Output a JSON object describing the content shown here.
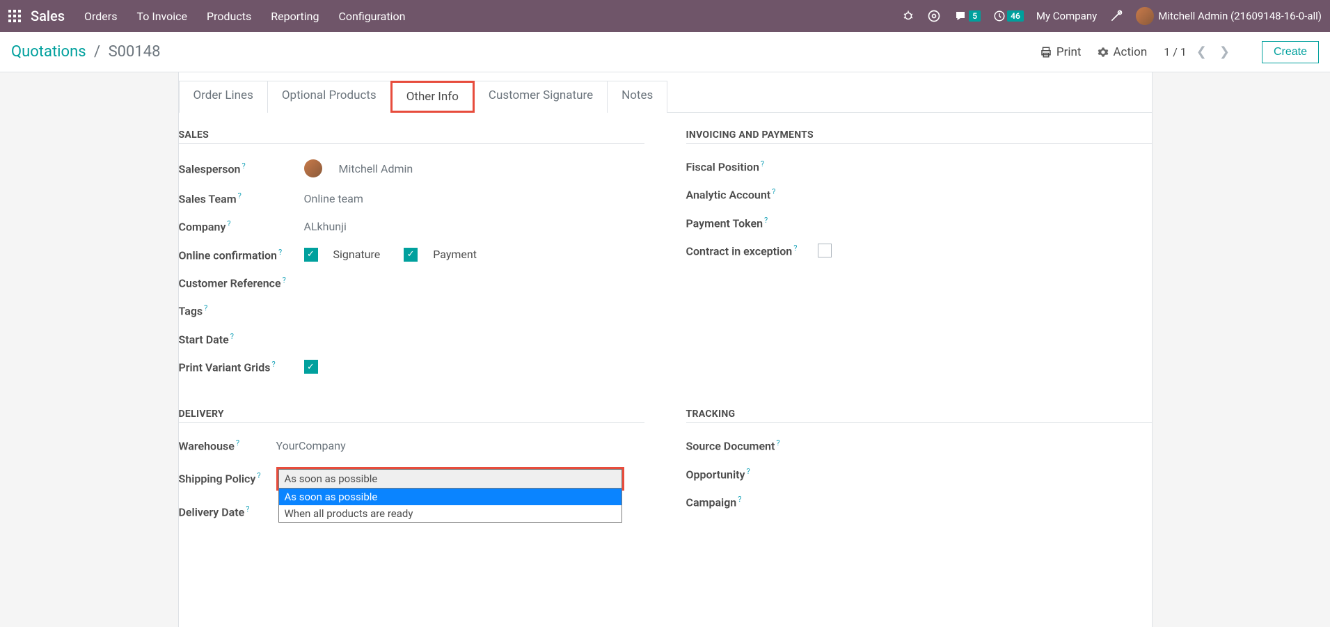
{
  "topbar": {
    "brand": "Sales",
    "menu": [
      "Orders",
      "To Invoice",
      "Products",
      "Reporting",
      "Configuration"
    ],
    "messages_count": "5",
    "activities_count": "46",
    "company": "My Company",
    "username": "Mitchell Admin (21609148-16-0-all)"
  },
  "controlbar": {
    "breadcrumb_parent": "Quotations",
    "breadcrumb_current": "S00148",
    "print_label": "Print",
    "action_label": "Action",
    "pager": "1 / 1",
    "create_label": "Create"
  },
  "tabs": [
    "Order Lines",
    "Optional Products",
    "Other Info",
    "Customer Signature",
    "Notes"
  ],
  "active_tab": "Other Info",
  "sections": {
    "sales": {
      "title": "SALES",
      "salesperson_label": "Salesperson",
      "salesperson_value": "Mitchell Admin",
      "sales_team_label": "Sales Team",
      "sales_team_value": "Online team",
      "company_label": "Company",
      "company_value": "ALkhunji",
      "online_conf_label": "Online confirmation",
      "signature_label": "Signature",
      "payment_label": "Payment",
      "customer_ref_label": "Customer Reference",
      "tags_label": "Tags",
      "start_date_label": "Start Date",
      "print_variant_label": "Print Variant Grids"
    },
    "invoicing": {
      "title": "INVOICING AND PAYMENTS",
      "fiscal_position_label": "Fiscal Position",
      "analytic_account_label": "Analytic Account",
      "payment_token_label": "Payment Token",
      "contract_exception_label": "Contract in exception"
    },
    "delivery": {
      "title": "DELIVERY",
      "warehouse_label": "Warehouse",
      "warehouse_value": "YourCompany",
      "shipping_policy_label": "Shipping Policy",
      "shipping_policy_value": "As soon as possible",
      "shipping_policy_options": [
        "As soon as possible",
        "When all products are ready"
      ],
      "delivery_date_label": "Delivery Date"
    },
    "tracking": {
      "title": "TRACKING",
      "source_doc_label": "Source Document",
      "opportunity_label": "Opportunity",
      "campaign_label": "Campaign"
    }
  }
}
